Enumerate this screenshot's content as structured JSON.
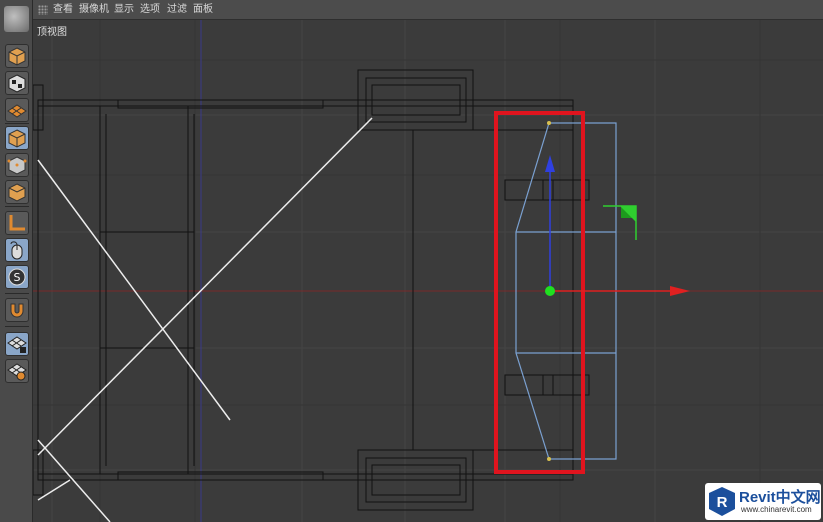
{
  "menubar": {
    "items": [
      "查看",
      "摄像机",
      "显示",
      "选项",
      "过滤",
      "面板"
    ]
  },
  "viewport": {
    "label": "顶视图",
    "highlight_color": "#e0141e",
    "axis_x_color": "#e02020",
    "axis_y_color": "#3030e0",
    "selection_color": "#7aa0d0",
    "pivot_color": "#20e020"
  },
  "toolbar": {
    "icons": [
      "cube-icon",
      "checker-cube-icon",
      "checker-plane-icon",
      "model-cube-icon",
      "points-cube-icon",
      "solid-cube-icon",
      "axis-corner-icon",
      "mouse-icon",
      "snap-s-icon",
      "magnet-icon",
      "grid-lock-icon",
      "grid-layer-icon"
    ]
  },
  "watermark": {
    "title": "Revit中文网",
    "url": "www.chinarevit.com"
  }
}
